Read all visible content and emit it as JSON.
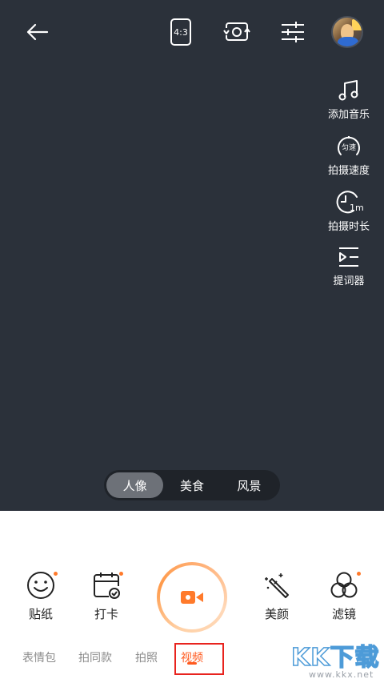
{
  "header": {
    "back_icon": "arrow-left-icon",
    "ratio_label": "4:3",
    "flip_icon": "camera-flip-icon",
    "adjust_icon": "sliders-icon",
    "avatar_icon": "avatar-thumbnail"
  },
  "side_tools": [
    {
      "label": "添加音乐",
      "icon": "music-note-icon"
    },
    {
      "label": "拍摄速度",
      "icon": "speed-gauge-icon",
      "icon_text": "匀速"
    },
    {
      "label": "拍摄时长",
      "icon": "clock-icon",
      "icon_text": "1m"
    },
    {
      "label": "提词器",
      "icon": "teleprompter-icon"
    }
  ],
  "filters": {
    "options": [
      "人像",
      "美食",
      "风景"
    ],
    "selected": "人像"
  },
  "bottom_tools": [
    {
      "label": "贴纸",
      "icon": "smiley-icon"
    },
    {
      "label": "打卡",
      "icon": "calendar-check-icon"
    },
    {
      "label": "美颜",
      "icon": "magic-wand-icon"
    },
    {
      "label": "滤镜",
      "icon": "filter-circles-icon"
    }
  ],
  "shutter": {
    "icon": "video-camera-icon"
  },
  "modes": {
    "items": [
      "表情包",
      "拍同款",
      "拍照",
      "视频"
    ],
    "selected": "视频"
  },
  "watermark": {
    "text": "KK下载",
    "url": "www.kkx.net"
  },
  "colors": {
    "viewfinder_bg": "#2b313a",
    "accent": "#ff7a2b",
    "highlight_box": "#e8231e"
  }
}
